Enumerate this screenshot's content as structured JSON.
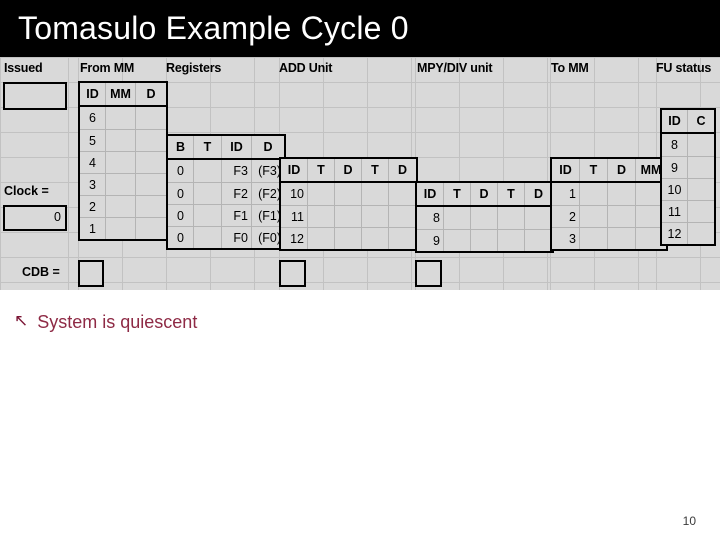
{
  "slide": {
    "title": "Tomasulo Example Cycle 0",
    "page_number": "10",
    "accent_color": "#8e2a45",
    "title_bar_color": "#000000",
    "sheet_background": "#d9d9d9"
  },
  "bullet": {
    "glyph": "↖",
    "text": "System is quiescent"
  },
  "sheet": {
    "section_titles": {
      "issued": "Issued",
      "from_mm": "From MM",
      "registers": "Registers",
      "add_unit": "ADD Unit",
      "mpy_div_unit": "MPY/DIV unit",
      "to_mm": "To MM",
      "fu_status": "FU status"
    },
    "side_labels": {
      "clock": "Clock =",
      "cdb": "CDB ="
    },
    "issued_box": {
      "value": ""
    },
    "clock_box": {
      "value": "0"
    },
    "cdb_box": {
      "value": ""
    },
    "from_mm": {
      "headers": [
        "ID",
        "MM",
        "D"
      ],
      "rows": [
        [
          "6",
          "",
          ""
        ],
        [
          "5",
          "",
          ""
        ],
        [
          "4",
          "",
          ""
        ],
        [
          "3",
          "",
          ""
        ],
        [
          "2",
          "",
          ""
        ],
        [
          "1",
          "",
          ""
        ]
      ]
    },
    "registers": {
      "headers": [
        "B",
        "T",
        "ID",
        "D"
      ],
      "rows": [
        [
          "0",
          "",
          "F3",
          "(F3)"
        ],
        [
          "0",
          "",
          "F2",
          "(F2)"
        ],
        [
          "0",
          "",
          "F1",
          "(F1)"
        ],
        [
          "0",
          "",
          "F0",
          "(F0)"
        ]
      ]
    },
    "add_unit": {
      "headers": [
        "ID",
        "T",
        "D",
        "T",
        "D"
      ],
      "rows": [
        [
          "10",
          "",
          "",
          "",
          ""
        ],
        [
          "11",
          "",
          "",
          "",
          ""
        ],
        [
          "12",
          "",
          "",
          "",
          ""
        ]
      ],
      "result_box": ""
    },
    "mpy_div_unit": {
      "headers": [
        "ID",
        "T",
        "D",
        "T",
        "D"
      ],
      "rows": [
        [
          "8",
          "",
          "",
          "",
          ""
        ],
        [
          "9",
          "",
          "",
          "",
          ""
        ]
      ],
      "result_box": ""
    },
    "to_mm": {
      "headers": [
        "ID",
        "T",
        "D",
        "MM"
      ],
      "rows": [
        [
          "1",
          "",
          "",
          ""
        ],
        [
          "2",
          "",
          "",
          ""
        ],
        [
          "3",
          "",
          "",
          ""
        ]
      ]
    },
    "fu_status": {
      "headers": [
        "ID",
        "C"
      ],
      "rows": [
        [
          "8",
          ""
        ],
        [
          "9",
          ""
        ],
        [
          "10",
          ""
        ],
        [
          "11",
          ""
        ],
        [
          "12",
          ""
        ]
      ]
    }
  }
}
